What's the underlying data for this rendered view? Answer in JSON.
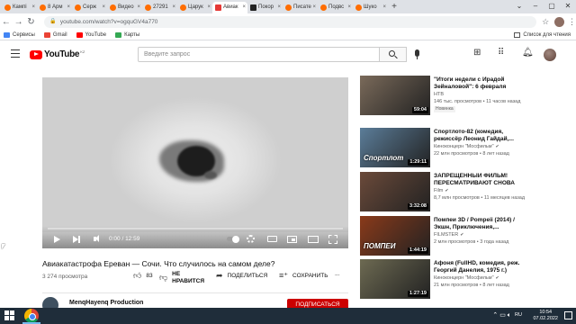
{
  "browser": {
    "tabs": [
      {
        "label": "Кампі",
        "icon": "orange"
      },
      {
        "label": "8 Арм",
        "icon": "orange"
      },
      {
        "label": "Серж",
        "icon": "orange"
      },
      {
        "label": "Видео",
        "icon": "orange"
      },
      {
        "label": "27291",
        "icon": "orange"
      },
      {
        "label": "Царук",
        "icon": "orange"
      },
      {
        "label": "Авиак",
        "icon": "youtube",
        "active": true
      },
      {
        "label": "Покор",
        "icon": "l"
      },
      {
        "label": "Писате",
        "icon": "orange"
      },
      {
        "label": "Подвс",
        "icon": "orange"
      },
      {
        "label": "Шуко",
        "icon": "orange"
      }
    ],
    "new_tab": "+",
    "url": "youtube.com/watch?v=ogquGV4a770",
    "bookmarks": [
      {
        "label": "Сервисы",
        "color": "#4285f4"
      },
      {
        "label": "Gmail",
        "color": "#ea4335"
      },
      {
        "label": "YouTube",
        "color": "#ff0000"
      },
      {
        "label": "Карты",
        "color": "#34a853"
      }
    ],
    "reading_list": "Список для чтения"
  },
  "youtube": {
    "logo_text": "YouTube",
    "country_code": "KZ",
    "search_placeholder": "Введите запрос"
  },
  "video": {
    "time": "0:00 / 12:59",
    "progress": 0.0,
    "title": "Авиакатастрофа Ереван — Сочи. Что случилось на самом деле?",
    "views": "3 274 просмотра",
    "likes": "83",
    "dislike_line1": "НЕ",
    "dislike_line2": "НРАВИТСЯ",
    "share": "ПОДЕЛИТЬСЯ",
    "save": "СОХРАНИТЬ",
    "more": "...",
    "channel": "MenqHayenq Production",
    "subscribe": "ПОДПИСАТЬСЯ"
  },
  "recommendations": [
    {
      "title": "\"Итоги недели с Ирадой Зейналовой\": 6 февраля 202...",
      "channel": "НТВ",
      "views": "146 тыс. просмотров",
      "age": "11 часов назад",
      "badge": "Новинка",
      "duration": "59:04",
      "thumb_color": "#7a6a5a",
      "thumb_text": ""
    },
    {
      "title": "Спортлото-82 (комедия, режиссёр Леонид Гайдай,...",
      "channel": "Киноконцерн \"Мосфильм\"",
      "views": "22 млн просмотров",
      "age": "8 лет назад",
      "badge": "",
      "duration": "1:29:11",
      "thumb_color": "#5b7d99",
      "thumb_text": "Спортлот"
    },
    {
      "title": "ЗАПРЕЩЕННЫЙ ФИЛЬМ! ПЕРЕСМАТРИВАЮТ СНОВА ...",
      "channel": "Film",
      "views": "8,7 млн просмотров",
      "age": "11 месяцев назад",
      "badge": "",
      "duration": "3:32:08",
      "thumb_color": "#6b4a3a",
      "thumb_text": ""
    },
    {
      "title": "Помпеи 3D / Pompeii (2014) / Экшн, Приключения,...",
      "channel": "FILMSTER",
      "views": "2 млн просмотров",
      "age": "3 года назад",
      "badge": "",
      "duration": "1:44:19",
      "thumb_color": "#8a3a1a",
      "thumb_text": "ПОМПЕИ"
    },
    {
      "title": "Афоня (FullHD, комедия, реж. Георгий Данелия, 1975 г.)",
      "channel": "Киноконцерн \"Мосфильм\"",
      "views": "21 млн просмотров",
      "age": "8 лет назад",
      "badge": "",
      "duration": "1:27:19",
      "thumb_color": "#6d6a52",
      "thumb_text": ""
    }
  ],
  "taskbar": {
    "lang": "RU",
    "time": "10:54",
    "date": "07.02.2022"
  }
}
